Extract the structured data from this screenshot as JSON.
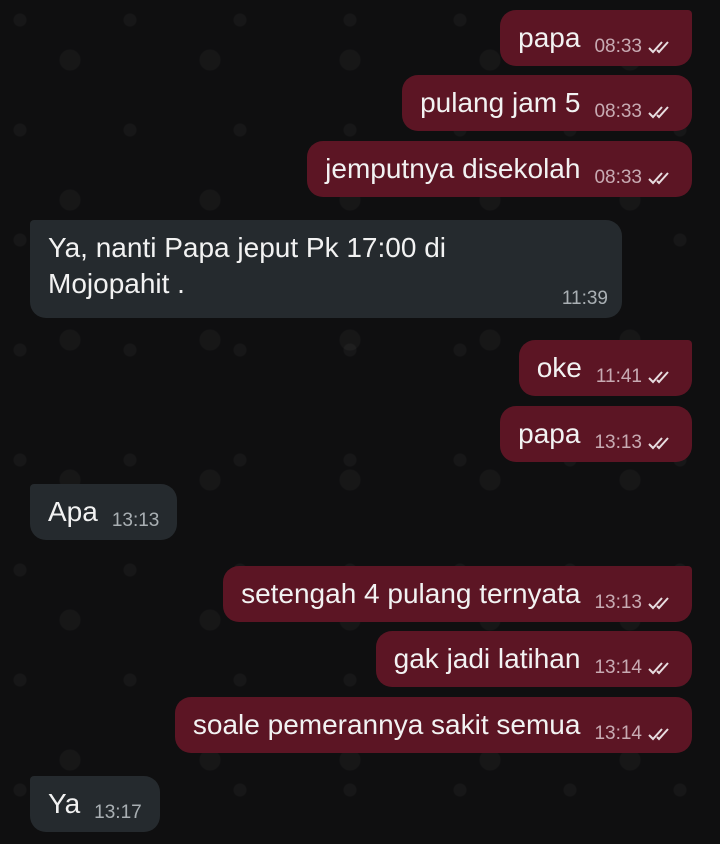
{
  "messages": [
    {
      "text": "papa",
      "time": "08:33"
    },
    {
      "text": "pulang jam 5",
      "time": "08:33"
    },
    {
      "text": "jemputnya disekolah",
      "time": "08:33"
    },
    {
      "line1": "Ya, nanti Papa jeput Pk 17:00 di",
      "line2": "Mojopahit .",
      "time": "11:39"
    },
    {
      "text": "oke",
      "time": "11:41"
    },
    {
      "text": "papa",
      "time": "13:13"
    },
    {
      "text": "Apa",
      "time": "13:13"
    },
    {
      "text": "setengah 4 pulang ternyata",
      "time": "13:13"
    },
    {
      "text": "gak jadi latihan",
      "time": "13:14"
    },
    {
      "text": "soale pemerannya sakit semua",
      "time": "13:14"
    },
    {
      "text": "Ya",
      "time": "13:17"
    }
  ],
  "colors": {
    "outgoing_bubble": "#5c1524",
    "incoming_bubble": "#252a2e",
    "background": "#0f0f10"
  },
  "icons": {
    "read_receipt": "double-check-icon"
  }
}
